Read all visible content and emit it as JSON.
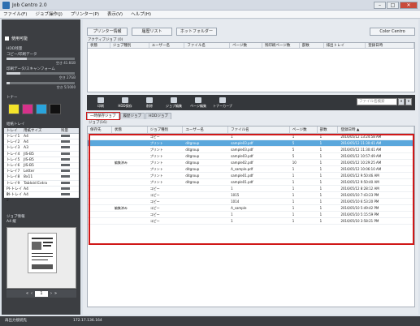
{
  "window": {
    "title": "Job Centro 2.0"
  },
  "menu": [
    "ファイル(F)",
    "ジョブ操作(J)",
    "プリンター(P)",
    "表示(V)",
    "ヘルプ(H)"
  ],
  "left": {
    "status": "使用可能",
    "hdd_label": "HDD残量",
    "copy_label": "コピー/印刷データ",
    "copy_value": "空き 41.6GB",
    "scan_label": "印刷データ/スキャンフォーム",
    "scan_value": "空き 27GB",
    "box_label": "一時保存ジョブ",
    "box_value": "空き 5/1000",
    "toner_label": "トナー",
    "tray_section": "給紙トレイ",
    "tray_headers": [
      "トレイ",
      "用紙サイズ",
      "残量"
    ],
    "trays": [
      {
        "tray": "トレイ1",
        "size": "A4"
      },
      {
        "tray": "トレイ2",
        "size": "A4"
      },
      {
        "tray": "トレイ3",
        "size": "A3"
      },
      {
        "tray": "トレイ4",
        "size": "JIS-B5"
      },
      {
        "tray": "トレイ5",
        "size": "JIS-B5"
      },
      {
        "tray": "トレイ6",
        "size": "JIS-B5"
      },
      {
        "tray": "トレイ7",
        "size": "Letter"
      },
      {
        "tray": "トレイ8",
        "size": "8x11"
      },
      {
        "tray": "トレイ9",
        "size": "Tabloid Extra"
      },
      {
        "tray": "PI-トレイ1",
        "size": "A4"
      },
      {
        "tray": "PI-トレイ2",
        "size": "A4"
      }
    ],
    "preview_label": "ジョブ情報",
    "preview_sub": "A4 縦",
    "page_value": "1"
  },
  "top_buttons": {
    "printer_info": "プリンター情報",
    "history": "履歴リスト",
    "hot_folder": "ホットフォルダー",
    "color_centro": "Color Centro"
  },
  "active": {
    "label": "アクティブジョブ (0)",
    "headers": [
      "状態",
      "ジョブ種別",
      "ユーザー名",
      "ファイル名",
      "ページ数",
      "残印刷ページ数",
      "部数",
      "排出トレイ",
      "登録日時"
    ]
  },
  "toolbar": {
    "buttons": [
      "印刷",
      "HDD保存",
      "削除",
      "ジョブ編集",
      "ページ編集",
      "トナーカーブ"
    ],
    "search_placeholder": "ファイル名検索"
  },
  "tabs": [
    "一時保存ジョブ",
    "履歴ジョブ",
    "HDDジョブ"
  ],
  "grid": {
    "count_label": "ジョブ(16)",
    "headers": [
      "保存先",
      "状態",
      "ジョブ種別",
      "ユーザー名",
      "ファイル名",
      "ページ数",
      "部数",
      "登録日時 ▲"
    ],
    "rows": [
      {
        "dest": "",
        "state": "",
        "type": "コピー",
        "user": "",
        "file": "1",
        "pages": "1",
        "copies": "1",
        "date": "2016/05/12 13:24:58 AM"
      },
      {
        "dest": "",
        "state": "",
        "type": "プリント",
        "user": "ditgroup",
        "file": "sample03.pdf",
        "pages": "5",
        "copies": "1",
        "date": "2016/05/12 11:30:41 AM"
      },
      {
        "dest": "",
        "state": "",
        "type": "プリント",
        "user": "ditgroup",
        "file": "sample03.pdf",
        "pages": "5",
        "copies": "1",
        "date": "2016/05/12 11:30:41 AM"
      },
      {
        "dest": "",
        "state": "",
        "type": "プリント",
        "user": "ditgroup",
        "file": "sample03.pdf",
        "pages": "5",
        "copies": "1",
        "date": "2016/05/12 10:57:49 AM"
      },
      {
        "dest": "",
        "state": "編集済み",
        "type": "プリント",
        "user": "ditgroup",
        "file": "sample02.pdf",
        "pages": "10",
        "copies": "1",
        "date": "2016/05/12 10:29:25 AM"
      },
      {
        "dest": "",
        "state": "",
        "type": "プリント",
        "user": "ditgroup",
        "file": "A_sample.pdf",
        "pages": "1",
        "copies": "1",
        "date": "2016/05/12 10:06:10 AM"
      },
      {
        "dest": "",
        "state": "",
        "type": "プリント",
        "user": "ditgroup",
        "file": "sample01.pdf",
        "pages": "1",
        "copies": "1",
        "date": "2016/05/12 9:50:46 AM"
      },
      {
        "dest": "",
        "state": "",
        "type": "プリント",
        "user": "ditgroup",
        "file": "sample01.pdf",
        "pages": "1",
        "copies": "1",
        "date": "2016/05/12 9:50:40 AM"
      },
      {
        "dest": "",
        "state": "",
        "type": "コピー",
        "user": "",
        "file": "1",
        "pages": "1",
        "copies": "1",
        "date": "2016/05/12 8:28:12 AM"
      },
      {
        "dest": "",
        "state": "",
        "type": "コピー",
        "user": "",
        "file": "1015",
        "pages": "1",
        "copies": "1",
        "date": "2016/05/10 7:43:23 PM"
      },
      {
        "dest": "",
        "state": "",
        "type": "コピー",
        "user": "",
        "file": "1014",
        "pages": "1",
        "copies": "1",
        "date": "2016/05/10 6:53:20 PM"
      },
      {
        "dest": "",
        "state": "編集済み",
        "type": "コピー",
        "user": "",
        "file": "A_sample",
        "pages": "1",
        "copies": "1",
        "date": "2016/05/10 5:49:42 PM"
      },
      {
        "dest": "",
        "state": "",
        "type": "コピー",
        "user": "",
        "file": "1",
        "pages": "1",
        "copies": "1",
        "date": "2016/05/10 5:15:59 PM"
      },
      {
        "dest": "",
        "state": "",
        "type": "コピー",
        "user": "",
        "file": "1",
        "pages": "1",
        "copies": "1",
        "date": "2016/05/10 3:58:21 PM"
      }
    ]
  },
  "status": {
    "left": "再出力接続先",
    "ip": "172.17.136.164"
  }
}
